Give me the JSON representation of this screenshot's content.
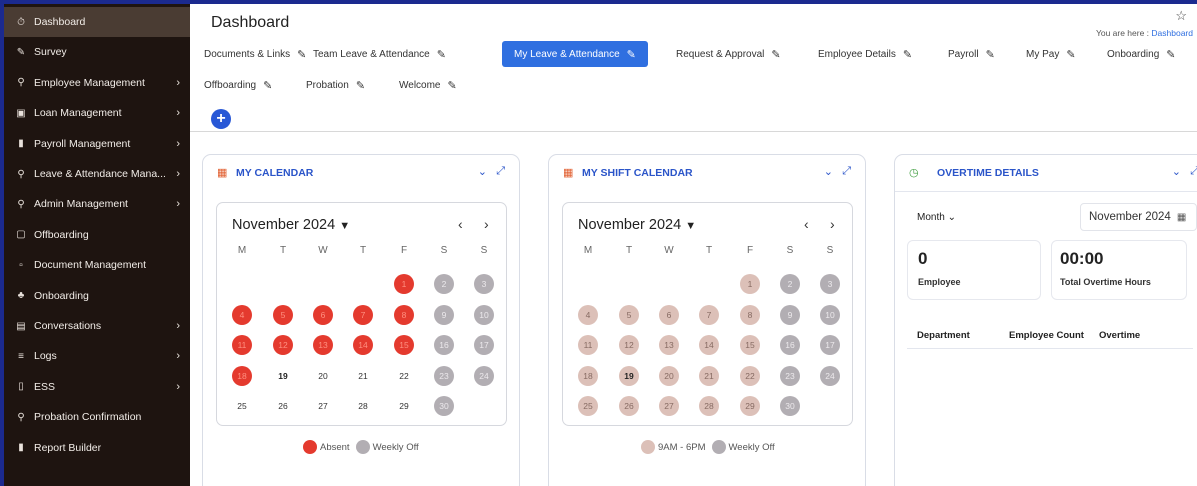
{
  "sidebar": {
    "items": [
      {
        "label": "Dashboard",
        "icon": "dashboard-icon",
        "glyph": "⏱",
        "arrow": false
      },
      {
        "label": "Survey",
        "icon": "survey-icon",
        "glyph": "✎",
        "arrow": false
      },
      {
        "label": "Employee Management",
        "icon": "user-icon",
        "glyph": "⚲",
        "arrow": true
      },
      {
        "label": "Loan Management",
        "icon": "briefcase-icon",
        "glyph": "▣",
        "arrow": true
      },
      {
        "label": "Payroll Management",
        "icon": "bar-chart-icon",
        "glyph": "▮",
        "arrow": true
      },
      {
        "label": "Leave & Attendance Mana...",
        "icon": "user-icon",
        "glyph": "⚲",
        "arrow": true
      },
      {
        "label": "Admin Management",
        "icon": "user-icon",
        "glyph": "⚲",
        "arrow": true
      },
      {
        "label": "Offboarding",
        "icon": "window-icon",
        "glyph": "▢",
        "arrow": false
      },
      {
        "label": "Document Management",
        "icon": "document-icon",
        "glyph": "▫",
        "arrow": false
      },
      {
        "label": "Onboarding",
        "icon": "people-icon",
        "glyph": "♣",
        "arrow": false
      },
      {
        "label": "Conversations",
        "icon": "chat-icon",
        "glyph": "▤",
        "arrow": true
      },
      {
        "label": "Logs",
        "icon": "list-icon",
        "glyph": "≡",
        "arrow": true
      },
      {
        "label": "ESS",
        "icon": "panel-icon",
        "glyph": "▯",
        "arrow": true
      },
      {
        "label": "Probation Confirmation",
        "icon": "user-icon",
        "glyph": "⚲",
        "arrow": false
      },
      {
        "label": "Report Builder",
        "icon": "bar-chart-icon",
        "glyph": "▮",
        "arrow": false
      }
    ]
  },
  "header": {
    "title": "Dashboard",
    "breadcrumb_prefix": "You are here : ",
    "breadcrumb_link": "Dashboard"
  },
  "tabs": [
    {
      "label": "Documents & Links",
      "active": false
    },
    {
      "label": "Team Leave & Attendance",
      "active": false
    },
    {
      "label": "My Leave & Attendance",
      "active": true
    },
    {
      "label": "Request & Approval",
      "active": false
    },
    {
      "label": "Employee Details",
      "active": false
    },
    {
      "label": "Payroll",
      "active": false
    },
    {
      "label": "My Pay",
      "active": false
    },
    {
      "label": "Onboarding",
      "active": false
    },
    {
      "label": "Offboarding",
      "active": false
    },
    {
      "label": "Probation",
      "active": false
    },
    {
      "label": "Welcome",
      "active": false
    }
  ],
  "add_button": "+",
  "weekdays": [
    "M",
    "T",
    "W",
    "T",
    "F",
    "S",
    "S"
  ],
  "my_calendar": {
    "title": "MY CALENDAR",
    "month": "November 2024",
    "first_weekday_index": 4,
    "days_in_month": 30,
    "today": 19,
    "absent_days": [
      1,
      4,
      5,
      6,
      7,
      8,
      11,
      12,
      13,
      14,
      15,
      18
    ],
    "weekly_off_days": [
      2,
      3,
      9,
      10,
      16,
      17,
      23,
      24,
      30
    ],
    "legend": [
      {
        "label": "Absent",
        "color": "#e43a2e"
      },
      {
        "label": "Weekly Off",
        "color": "#b2aeb3"
      }
    ]
  },
  "shift_calendar": {
    "title": "MY SHIFT CALENDAR",
    "month": "November 2024",
    "first_weekday_index": 4,
    "days_in_month": 30,
    "today": 19,
    "shift_days": [
      1,
      4,
      5,
      6,
      7,
      8,
      11,
      12,
      13,
      14,
      15,
      18,
      19,
      20,
      21,
      22,
      25,
      26,
      27,
      28,
      29
    ],
    "weekly_off_days": [
      2,
      3,
      9,
      10,
      16,
      17,
      23,
      24,
      30
    ],
    "legend": [
      {
        "label": "9AM - 6PM",
        "color": "#dcc0b8"
      },
      {
        "label": "Weekly Off",
        "color": "#b2aeb3"
      }
    ]
  },
  "overtime": {
    "title": "OVERTIME DETAILS",
    "period_select": "Month",
    "date_value": "November 2024",
    "employee_count": "0",
    "employee_label": "Employee",
    "total_hours": "00:00",
    "total_hours_label": "Total Overtime Hours",
    "columns": [
      "Department",
      "Employee Count",
      "Overtime"
    ]
  },
  "colors": {
    "accent": "#2f6fe0",
    "sidebar_bg": "#1e1410",
    "absent": "#e43a2e",
    "weekly_off": "#b2aeb3",
    "shift": "#dcc0b8"
  }
}
